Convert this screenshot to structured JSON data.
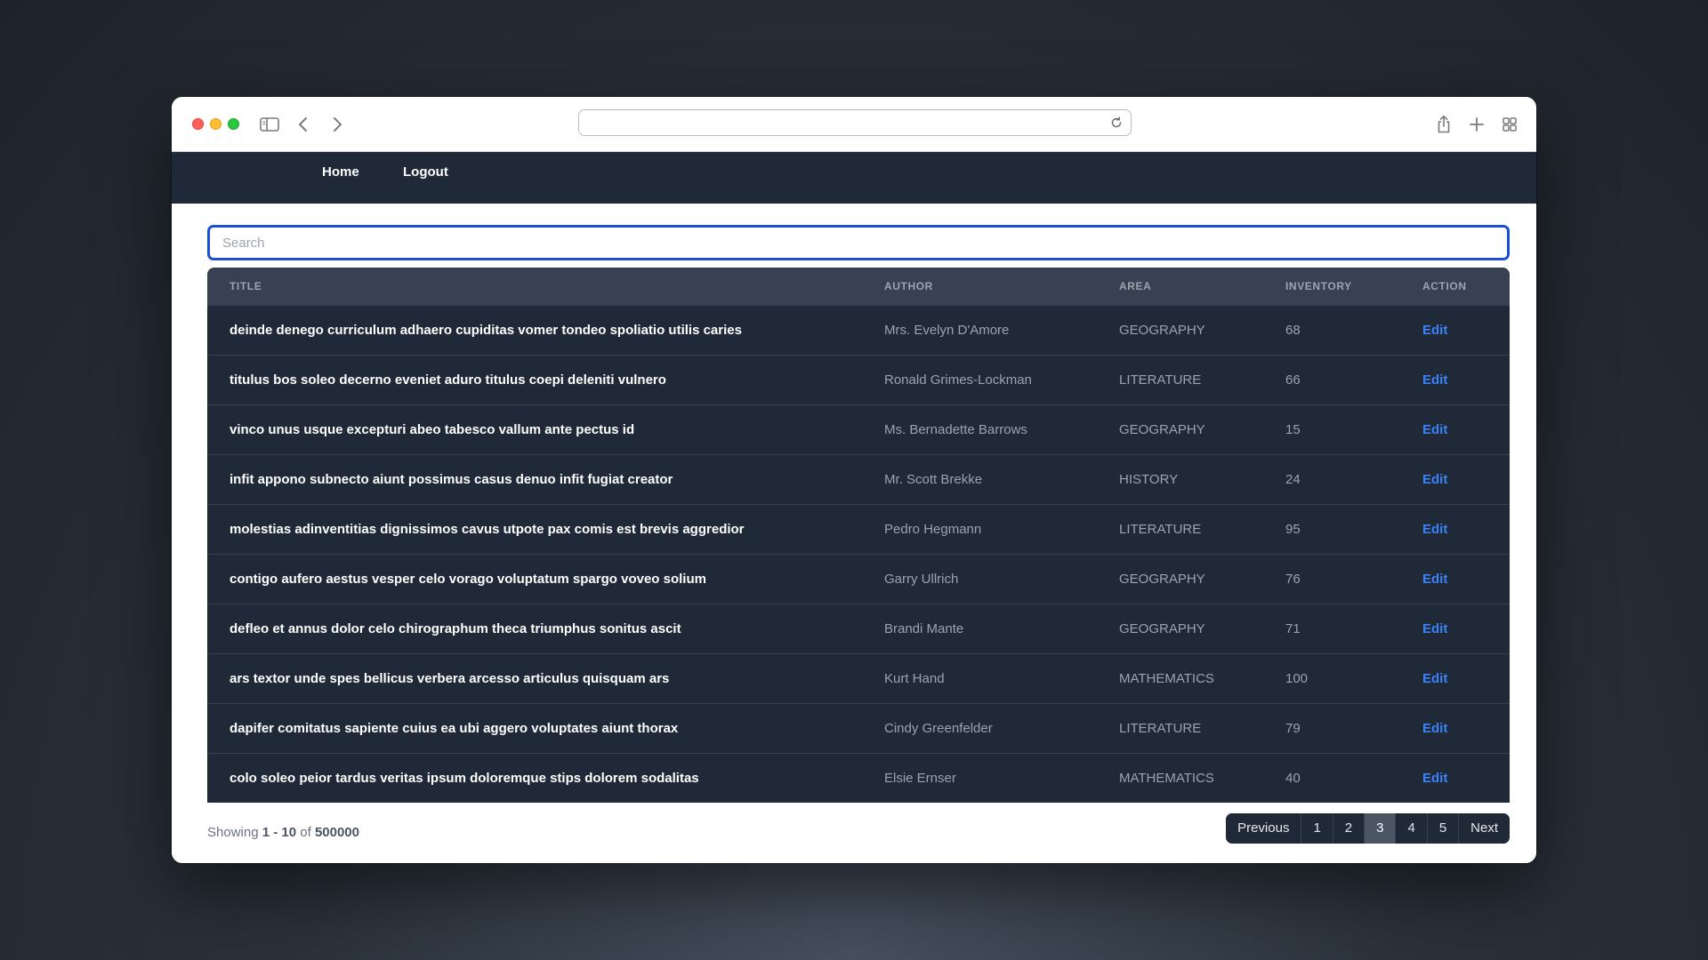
{
  "browser": {
    "url": ""
  },
  "nav": {
    "home_label": "Home",
    "logout_label": "Logout"
  },
  "search": {
    "placeholder": "Search",
    "value": ""
  },
  "table": {
    "columns": [
      "TITLE",
      "AUTHOR",
      "AREA",
      "INVENTORY",
      "ACTION"
    ],
    "rows": [
      {
        "title": "deinde denego curriculum adhaero cupiditas vomer tondeo spoliatio utilis caries",
        "author": "Mrs. Evelyn D'Amore",
        "area": "GEOGRAPHY",
        "inventory": "68",
        "action": "Edit"
      },
      {
        "title": "titulus bos soleo decerno eveniet aduro titulus coepi deleniti vulnero",
        "author": "Ronald Grimes-Lockman",
        "area": "LITERATURE",
        "inventory": "66",
        "action": "Edit"
      },
      {
        "title": "vinco unus usque excepturi abeo tabesco vallum ante pectus id",
        "author": "Ms. Bernadette Barrows",
        "area": "GEOGRAPHY",
        "inventory": "15",
        "action": "Edit"
      },
      {
        "title": "infit appono subnecto aiunt possimus casus denuo infit fugiat creator",
        "author": "Mr. Scott Brekke",
        "area": "HISTORY",
        "inventory": "24",
        "action": "Edit"
      },
      {
        "title": "molestias adinventitias dignissimos cavus utpote pax comis est brevis aggredior",
        "author": "Pedro Hegmann",
        "area": "LITERATURE",
        "inventory": "95",
        "action": "Edit"
      },
      {
        "title": "contigo aufero aestus vesper celo vorago voluptatum spargo voveo solium",
        "author": "Garry Ullrich",
        "area": "GEOGRAPHY",
        "inventory": "76",
        "action": "Edit"
      },
      {
        "title": "defleo et annus dolor celo chirographum theca triumphus sonitus ascit",
        "author": "Brandi Mante",
        "area": "GEOGRAPHY",
        "inventory": "71",
        "action": "Edit"
      },
      {
        "title": "ars textor unde spes bellicus verbera arcesso articulus quisquam ars",
        "author": "Kurt Hand",
        "area": "MATHEMATICS",
        "inventory": "100",
        "action": "Edit"
      },
      {
        "title": "dapifer comitatus sapiente cuius ea ubi aggero voluptates aiunt thorax",
        "author": "Cindy Greenfelder",
        "area": "LITERATURE",
        "inventory": "79",
        "action": "Edit"
      },
      {
        "title": "colo soleo peior tardus veritas ipsum doloremque stips dolorem sodalitas",
        "author": "Elsie Ernser",
        "area": "MATHEMATICS",
        "inventory": "40",
        "action": "Edit"
      }
    ]
  },
  "footer": {
    "showing_prefix": "Showing",
    "range": "1 - 10",
    "of_label": "of",
    "total": "500000"
  },
  "pagination": {
    "previous_label": "Previous",
    "pages": [
      "1",
      "2",
      "3",
      "4",
      "5"
    ],
    "current_page": "3",
    "next_label": "Next"
  },
  "colors": {
    "navbar": "#1f2937",
    "table_header": "#374151",
    "accent": "#3b82f6",
    "search_border": "#1d4ed8"
  },
  "icons": [
    "sidebar-icon",
    "back-arrow-icon",
    "forward-arrow-icon",
    "reload-icon",
    "share-icon",
    "new-tab-icon",
    "tab-overview-icon"
  ]
}
